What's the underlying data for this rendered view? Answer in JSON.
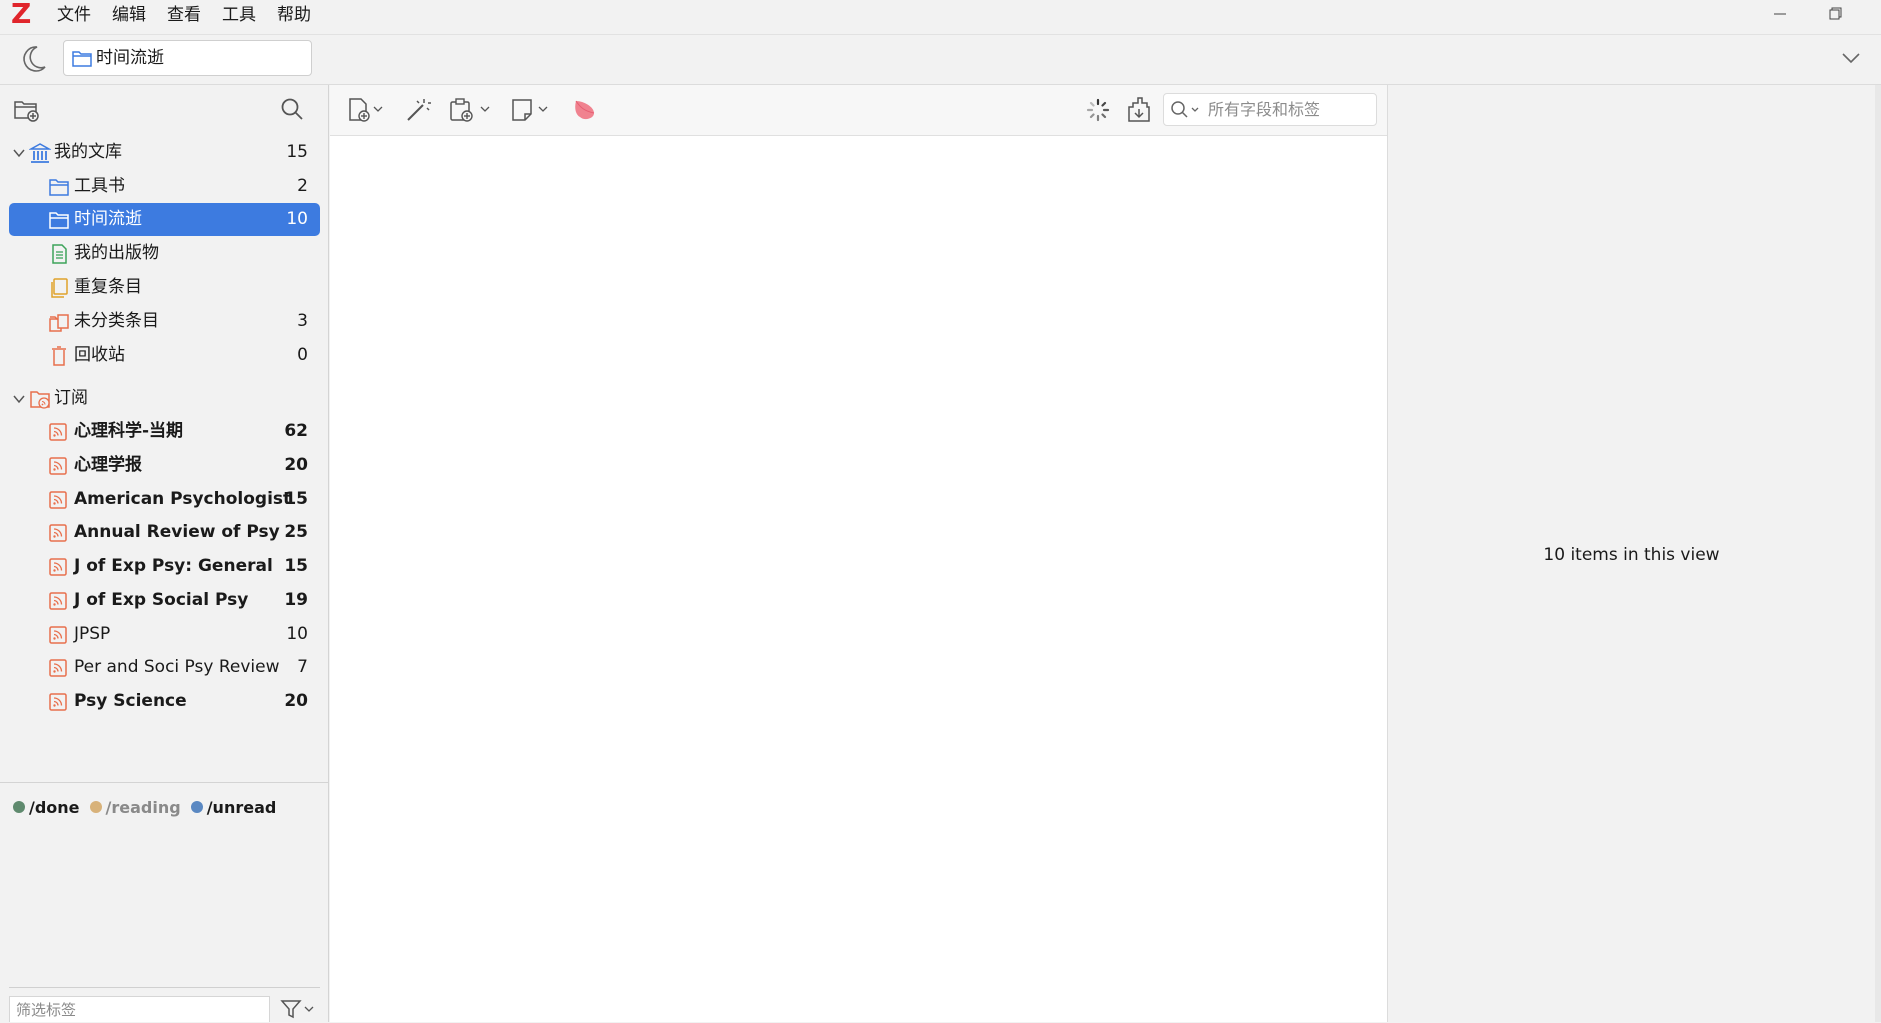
{
  "app": {
    "logo": "Z"
  },
  "menu": [
    "文件",
    "编辑",
    "查看",
    "工具",
    "帮助"
  ],
  "tab": {
    "label": "时间流逝"
  },
  "library": {
    "name": "我的文库",
    "count": "15",
    "items": [
      {
        "label": "工具书",
        "count": "2",
        "icon": "folder-icon"
      },
      {
        "label": "时间流逝",
        "count": "10",
        "icon": "folder-icon",
        "selected": true
      },
      {
        "label": "我的出版物",
        "count": "",
        "icon": "publications-icon"
      },
      {
        "label": "重复条目",
        "count": "",
        "icon": "duplicates-icon"
      },
      {
        "label": "未分类条目",
        "count": "3",
        "icon": "unfiled-icon"
      },
      {
        "label": "回收站",
        "count": "0",
        "icon": "trash-icon"
      }
    ]
  },
  "feeds": {
    "name": "订阅",
    "items": [
      {
        "label": "心理科学-当期",
        "count": "62",
        "bold": true
      },
      {
        "label": "心理学报",
        "count": "20",
        "bold": true
      },
      {
        "label": "American Psychologist",
        "count": "15",
        "bold": true
      },
      {
        "label": "Annual Review of Psy",
        "count": "25",
        "bold": true
      },
      {
        "label": "J of Exp Psy: General",
        "count": "15",
        "bold": true
      },
      {
        "label": "J of Exp Social Psy",
        "count": "19",
        "bold": true
      },
      {
        "label": "JPSP",
        "count": "10",
        "bold": false
      },
      {
        "label": "Per and Soci Psy Review",
        "count": "7",
        "bold": false
      },
      {
        "label": "Psy Science",
        "count": "20",
        "bold": true
      }
    ]
  },
  "tags": [
    {
      "label": "/done",
      "color": "#5f8a6e",
      "text_color": "#1a1a1a"
    },
    {
      "label": "/reading",
      "color": "#d8b27a",
      "text_color": "#8a8a8a"
    },
    {
      "label": "/unread",
      "color": "#5a88c2",
      "text_color": "#1a1a1a"
    }
  ],
  "tag_filter": {
    "placeholder": "筛选标签"
  },
  "search": {
    "placeholder": "所有字段和标签"
  },
  "item_pane": {
    "message": "10 items in this view"
  },
  "colors": {
    "accent": "#3d7be0",
    "feed_icon": "#e86f4c",
    "folder_icon": "#3d7be0",
    "logo": "#e0252b"
  }
}
